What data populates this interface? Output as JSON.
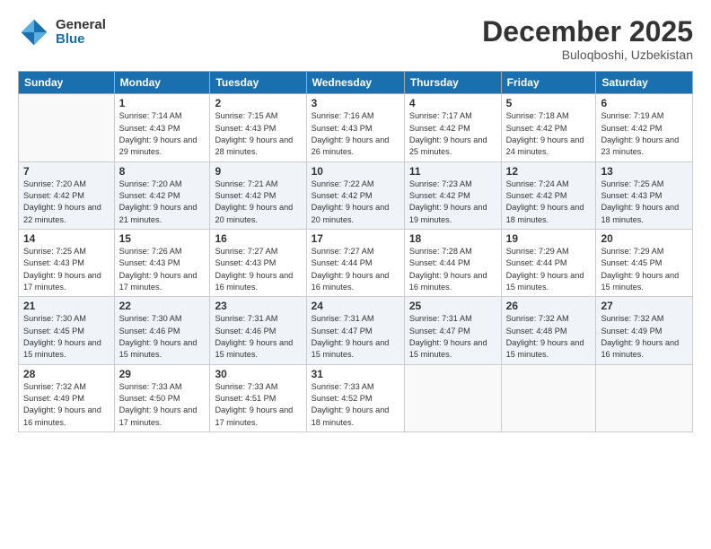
{
  "logo": {
    "general": "General",
    "blue": "Blue"
  },
  "header": {
    "month": "December 2025",
    "location": "Buloqboshi, Uzbekistan"
  },
  "weekdays": [
    "Sunday",
    "Monday",
    "Tuesday",
    "Wednesday",
    "Thursday",
    "Friday",
    "Saturday"
  ],
  "weeks": [
    [
      {
        "day": "",
        "sunrise": "",
        "sunset": "",
        "daylight": ""
      },
      {
        "day": "1",
        "sunrise": "Sunrise: 7:14 AM",
        "sunset": "Sunset: 4:43 PM",
        "daylight": "Daylight: 9 hours and 29 minutes."
      },
      {
        "day": "2",
        "sunrise": "Sunrise: 7:15 AM",
        "sunset": "Sunset: 4:43 PM",
        "daylight": "Daylight: 9 hours and 28 minutes."
      },
      {
        "day": "3",
        "sunrise": "Sunrise: 7:16 AM",
        "sunset": "Sunset: 4:43 PM",
        "daylight": "Daylight: 9 hours and 26 minutes."
      },
      {
        "day": "4",
        "sunrise": "Sunrise: 7:17 AM",
        "sunset": "Sunset: 4:42 PM",
        "daylight": "Daylight: 9 hours and 25 minutes."
      },
      {
        "day": "5",
        "sunrise": "Sunrise: 7:18 AM",
        "sunset": "Sunset: 4:42 PM",
        "daylight": "Daylight: 9 hours and 24 minutes."
      },
      {
        "day": "6",
        "sunrise": "Sunrise: 7:19 AM",
        "sunset": "Sunset: 4:42 PM",
        "daylight": "Daylight: 9 hours and 23 minutes."
      }
    ],
    [
      {
        "day": "7",
        "sunrise": "Sunrise: 7:20 AM",
        "sunset": "Sunset: 4:42 PM",
        "daylight": "Daylight: 9 hours and 22 minutes."
      },
      {
        "day": "8",
        "sunrise": "Sunrise: 7:20 AM",
        "sunset": "Sunset: 4:42 PM",
        "daylight": "Daylight: 9 hours and 21 minutes."
      },
      {
        "day": "9",
        "sunrise": "Sunrise: 7:21 AM",
        "sunset": "Sunset: 4:42 PM",
        "daylight": "Daylight: 9 hours and 20 minutes."
      },
      {
        "day": "10",
        "sunrise": "Sunrise: 7:22 AM",
        "sunset": "Sunset: 4:42 PM",
        "daylight": "Daylight: 9 hours and 20 minutes."
      },
      {
        "day": "11",
        "sunrise": "Sunrise: 7:23 AM",
        "sunset": "Sunset: 4:42 PM",
        "daylight": "Daylight: 9 hours and 19 minutes."
      },
      {
        "day": "12",
        "sunrise": "Sunrise: 7:24 AM",
        "sunset": "Sunset: 4:42 PM",
        "daylight": "Daylight: 9 hours and 18 minutes."
      },
      {
        "day": "13",
        "sunrise": "Sunrise: 7:25 AM",
        "sunset": "Sunset: 4:43 PM",
        "daylight": "Daylight: 9 hours and 18 minutes."
      }
    ],
    [
      {
        "day": "14",
        "sunrise": "Sunrise: 7:25 AM",
        "sunset": "Sunset: 4:43 PM",
        "daylight": "Daylight: 9 hours and 17 minutes."
      },
      {
        "day": "15",
        "sunrise": "Sunrise: 7:26 AM",
        "sunset": "Sunset: 4:43 PM",
        "daylight": "Daylight: 9 hours and 17 minutes."
      },
      {
        "day": "16",
        "sunrise": "Sunrise: 7:27 AM",
        "sunset": "Sunset: 4:43 PM",
        "daylight": "Daylight: 9 hours and 16 minutes."
      },
      {
        "day": "17",
        "sunrise": "Sunrise: 7:27 AM",
        "sunset": "Sunset: 4:44 PM",
        "daylight": "Daylight: 9 hours and 16 minutes."
      },
      {
        "day": "18",
        "sunrise": "Sunrise: 7:28 AM",
        "sunset": "Sunset: 4:44 PM",
        "daylight": "Daylight: 9 hours and 16 minutes."
      },
      {
        "day": "19",
        "sunrise": "Sunrise: 7:29 AM",
        "sunset": "Sunset: 4:44 PM",
        "daylight": "Daylight: 9 hours and 15 minutes."
      },
      {
        "day": "20",
        "sunrise": "Sunrise: 7:29 AM",
        "sunset": "Sunset: 4:45 PM",
        "daylight": "Daylight: 9 hours and 15 minutes."
      }
    ],
    [
      {
        "day": "21",
        "sunrise": "Sunrise: 7:30 AM",
        "sunset": "Sunset: 4:45 PM",
        "daylight": "Daylight: 9 hours and 15 minutes."
      },
      {
        "day": "22",
        "sunrise": "Sunrise: 7:30 AM",
        "sunset": "Sunset: 4:46 PM",
        "daylight": "Daylight: 9 hours and 15 minutes."
      },
      {
        "day": "23",
        "sunrise": "Sunrise: 7:31 AM",
        "sunset": "Sunset: 4:46 PM",
        "daylight": "Daylight: 9 hours and 15 minutes."
      },
      {
        "day": "24",
        "sunrise": "Sunrise: 7:31 AM",
        "sunset": "Sunset: 4:47 PM",
        "daylight": "Daylight: 9 hours and 15 minutes."
      },
      {
        "day": "25",
        "sunrise": "Sunrise: 7:31 AM",
        "sunset": "Sunset: 4:47 PM",
        "daylight": "Daylight: 9 hours and 15 minutes."
      },
      {
        "day": "26",
        "sunrise": "Sunrise: 7:32 AM",
        "sunset": "Sunset: 4:48 PM",
        "daylight": "Daylight: 9 hours and 15 minutes."
      },
      {
        "day": "27",
        "sunrise": "Sunrise: 7:32 AM",
        "sunset": "Sunset: 4:49 PM",
        "daylight": "Daylight: 9 hours and 16 minutes."
      }
    ],
    [
      {
        "day": "28",
        "sunrise": "Sunrise: 7:32 AM",
        "sunset": "Sunset: 4:49 PM",
        "daylight": "Daylight: 9 hours and 16 minutes."
      },
      {
        "day": "29",
        "sunrise": "Sunrise: 7:33 AM",
        "sunset": "Sunset: 4:50 PM",
        "daylight": "Daylight: 9 hours and 17 minutes."
      },
      {
        "day": "30",
        "sunrise": "Sunrise: 7:33 AM",
        "sunset": "Sunset: 4:51 PM",
        "daylight": "Daylight: 9 hours and 17 minutes."
      },
      {
        "day": "31",
        "sunrise": "Sunrise: 7:33 AM",
        "sunset": "Sunset: 4:52 PM",
        "daylight": "Daylight: 9 hours and 18 minutes."
      },
      {
        "day": "",
        "sunrise": "",
        "sunset": "",
        "daylight": ""
      },
      {
        "day": "",
        "sunrise": "",
        "sunset": "",
        "daylight": ""
      },
      {
        "day": "",
        "sunrise": "",
        "sunset": "",
        "daylight": ""
      }
    ]
  ]
}
